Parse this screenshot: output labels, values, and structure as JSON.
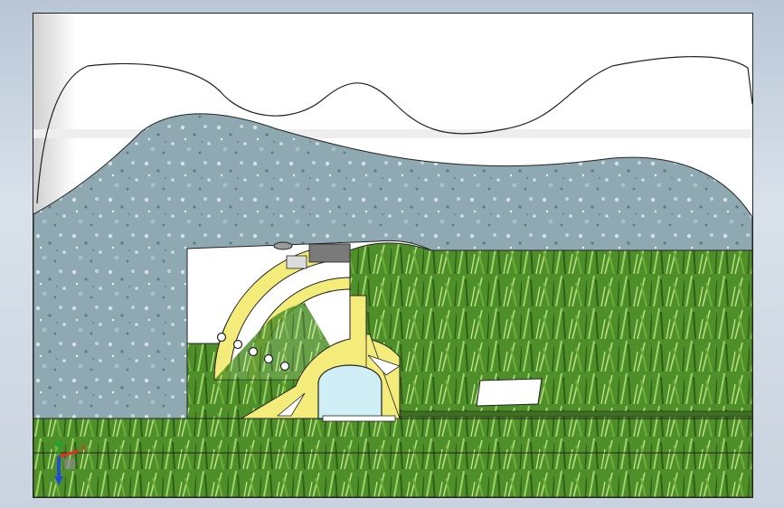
{
  "view": {
    "background": "#ffffff",
    "border_color": "#222222"
  },
  "layers": {
    "sky": {
      "color": "#ffffff",
      "shadow": "#d8d8d8"
    },
    "rock": {
      "color": "#8fa9b3",
      "speckle_light": "#d4e2e6",
      "speckle_dark": "#5e7780"
    },
    "grass": {
      "color": "#4f8f2a",
      "blade_light": "#9ed46a",
      "blade_dark": "#2f5e16"
    },
    "tunnel_lining": {
      "color": "#f4ec7a",
      "outline": "#333333"
    },
    "tunnel_opening": {
      "color": "#cfeef5"
    },
    "cutter_head": {
      "color": "#ffffff",
      "segment": "#f4ec7a",
      "dark_segment": "#7a7a7a"
    }
  },
  "triad": {
    "x_axis_color": "#e03030",
    "y_axis_color": "#2ca02c",
    "z_axis_color": "#2050d0",
    "x_label": "X",
    "icons": [
      "x-axis-icon",
      "y-axis-icon",
      "z-axis-icon"
    ]
  }
}
